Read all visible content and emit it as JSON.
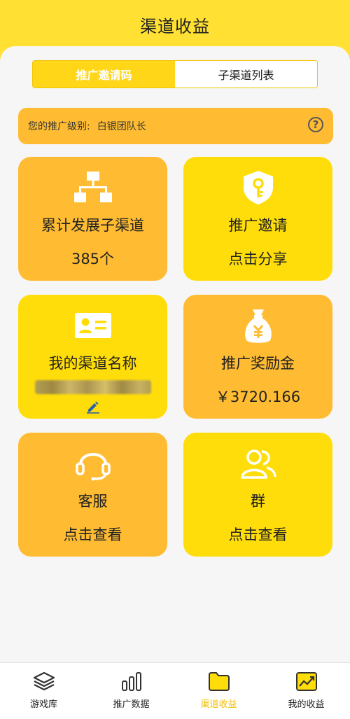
{
  "header": {
    "title": "渠道收益"
  },
  "tabs": [
    {
      "label": "推广邀请码",
      "active": true
    },
    {
      "label": "子渠道列表",
      "active": false
    }
  ],
  "level": {
    "label": "您的推广级别:",
    "value": "白银团队长"
  },
  "cards": {
    "subchannels": {
      "title": "累计发展子渠道",
      "value": "385个",
      "icon": "hierarchy-icon"
    },
    "invite": {
      "title": "推广邀请",
      "value": "点击分享",
      "icon": "shield-key-icon"
    },
    "channel_name": {
      "title": "我的渠道名称",
      "icon": "id-card-icon"
    },
    "bonus": {
      "title": "推广奖励金",
      "value": "￥3720.166",
      "icon": "money-bag-icon"
    },
    "service": {
      "title": "客服",
      "value": "点击查看",
      "icon": "headset-icon"
    },
    "group": {
      "title": "群",
      "value": "点击查看",
      "icon": "users-icon"
    }
  },
  "nav": [
    {
      "label": "游戏库",
      "icon": "layers-icon"
    },
    {
      "label": "推广数据",
      "icon": "bar-chart-icon"
    },
    {
      "label": "渠道收益",
      "icon": "folder-icon",
      "active": true
    },
    {
      "label": "我的收益",
      "icon": "trend-chart-icon"
    }
  ],
  "colors": {
    "brand_yellow": "#ffdd0a",
    "brand_orange": "#ffbc32",
    "active_nav": "#f2bf00"
  }
}
